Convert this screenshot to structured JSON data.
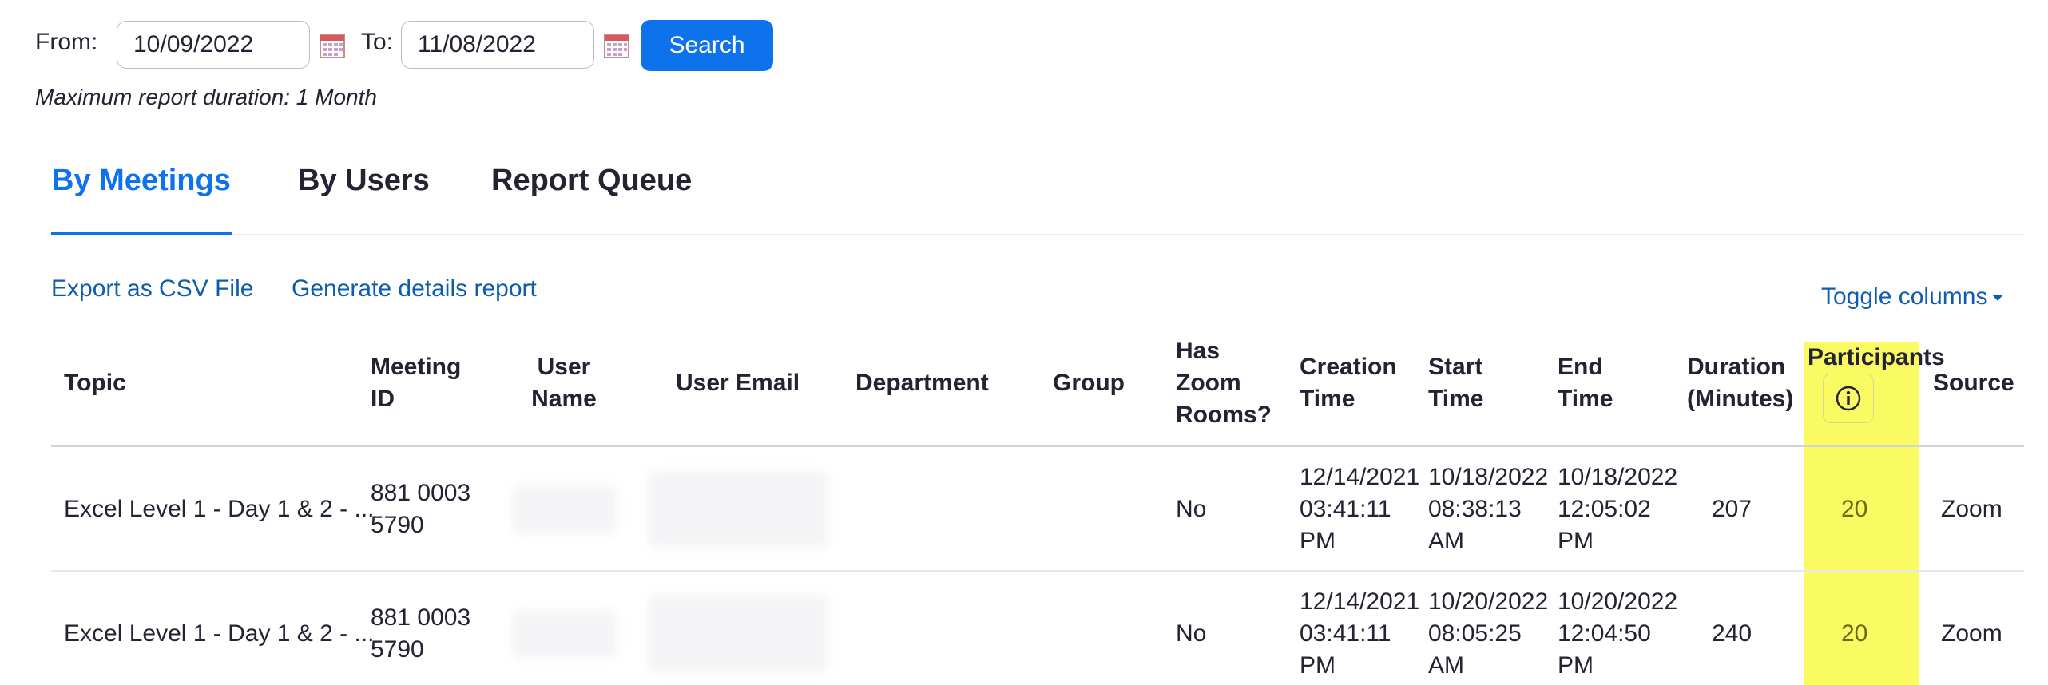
{
  "filters": {
    "from_label": "From:",
    "from_value": "10/09/2022",
    "to_label": "To:",
    "to_value": "11/08/2022",
    "search_label": "Search",
    "note": "Maximum report duration: 1 Month"
  },
  "tabs": [
    {
      "label": "By Meetings",
      "active": true
    },
    {
      "label": "By Users",
      "active": false
    },
    {
      "label": "Report Queue",
      "active": false
    }
  ],
  "actions": {
    "export_csv": "Export as CSV File",
    "generate_details": "Generate details report",
    "toggle_columns": "Toggle columns"
  },
  "table": {
    "headers": {
      "topic": "Topic",
      "meeting_id": [
        "Meeting",
        "ID"
      ],
      "user_name": [
        "User",
        "Name"
      ],
      "user_email": "User Email",
      "department": "Department",
      "group": "Group",
      "has_zoom_rooms": [
        "Has",
        "Zoom",
        "Rooms?"
      ],
      "creation_time": [
        "Creation",
        "Time"
      ],
      "start_time": [
        "Start",
        "Time"
      ],
      "end_time": [
        "End",
        "Time"
      ],
      "duration": [
        "Duration",
        "(Minutes)"
      ],
      "participants": "Participants",
      "source": "Source"
    },
    "rows": [
      {
        "topic": "Excel Level 1 - Day 1 & 2 - ...",
        "meeting_id": [
          "881 0003",
          "5790"
        ],
        "user_name": "",
        "user_email": "",
        "department": "",
        "group": "",
        "has_zoom_rooms": "No",
        "creation_time": [
          "12/14/2021",
          "03:41:11",
          "PM"
        ],
        "start_time": [
          "10/18/2022",
          "08:38:13",
          "AM"
        ],
        "end_time": [
          "10/18/2022",
          "12:05:02",
          "PM"
        ],
        "duration": "207",
        "participants": "20",
        "source": "Zoom"
      },
      {
        "topic": "Excel Level 1 - Day 1 & 2 - ...",
        "meeting_id": [
          "881 0003",
          "5790"
        ],
        "user_name": "",
        "user_email": "",
        "department": "",
        "group": "",
        "has_zoom_rooms": "No",
        "creation_time": [
          "12/14/2021",
          "03:41:11",
          "PM"
        ],
        "start_time": [
          "10/20/2022",
          "08:05:25",
          "AM"
        ],
        "end_time": [
          "10/20/2022",
          "12:04:50",
          "PM"
        ],
        "duration": "240",
        "participants": "20",
        "source": "Zoom"
      }
    ]
  },
  "colors": {
    "accent": "#0e72ed",
    "link": "#0e5cad",
    "highlight": "#fafb63"
  },
  "icons": {
    "calendar": "calendar-icon",
    "info": "info-icon",
    "caret": "caret-down-icon"
  }
}
